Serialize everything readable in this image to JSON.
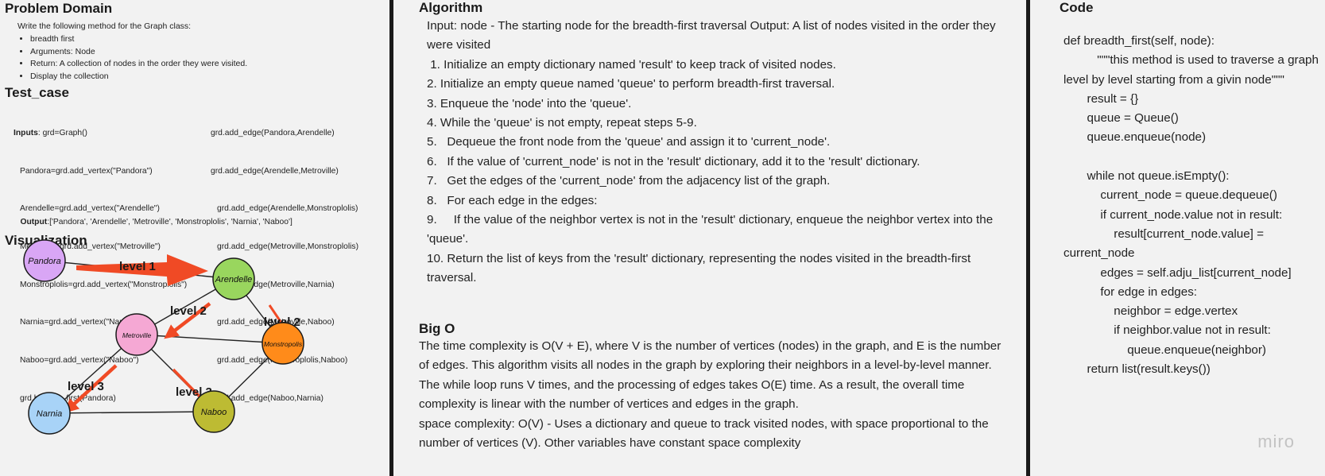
{
  "problem_domain": {
    "title": "Problem Domain",
    "intro": "Write the following method for the Graph class:",
    "bullets": [
      "breadth first",
      "Arguments: Node",
      "Return: A collection of nodes in the order they were visited.",
      "Display the collection"
    ]
  },
  "test_case": {
    "title": "Test_case",
    "inputs_label": "Inputs",
    "left_lines": [
      ": grd=Graph()",
      "Pandora=grd.add_vertex(\"Pandora\")",
      "Arendelle=grd.add_vertex(\"Arendelle\")",
      "Metroville=grd.add_vertex(\"Metroville\")",
      "Monstroplolis=grd.add_vertex(\"Monstroplolis\")",
      "Narnia=grd.add_vertex(\"Narnia\")",
      "Naboo=grd.add_vertex(\"Naboo\")",
      "grd.breadth_first(Pandora)"
    ],
    "right_lines": [
      "grd.add_edge(Pandora,Arendelle)",
      "grd.add_edge(Arendelle,Metroville)",
      "grd.add_edge(Arendelle,Monstroplolis)",
      "grd.add_edge(Metroville,Monstroplolis)",
      "grd.add_edge(Metroville,Narnia)",
      "grd.add_edge(Metroville,Naboo)",
      "grd.add_edge(Monstroplolis,Naboo)",
      "grd.add_edge(Naboo,Narnia)"
    ],
    "output_label": "Output",
    "output_value": ":['Pandora', 'Arendelle', 'Metroville', 'Monstroplolis', 'Narnia', 'Naboo']"
  },
  "visualization": {
    "title": "Visualization",
    "nodes": [
      {
        "id": "pandora",
        "label": "Pandora",
        "color": "#d9a6f5"
      },
      {
        "id": "arendelle",
        "label": "Arendelle",
        "color": "#99d65e"
      },
      {
        "id": "metroville",
        "label": "Metroville",
        "color": "#f5a8d4"
      },
      {
        "id": "monstropolis",
        "label": "Monstropolis",
        "color": "#ff8b1a"
      },
      {
        "id": "narnia",
        "label": "Narnia",
        "color": "#a8d3f7"
      },
      {
        "id": "naboo",
        "label": "Naboo",
        "color": "#bdbb33"
      }
    ],
    "edges": [
      [
        "pandora",
        "arendelle"
      ],
      [
        "arendelle",
        "metroville"
      ],
      [
        "arendelle",
        "monstropolis"
      ],
      [
        "metroville",
        "monstropolis"
      ],
      [
        "metroville",
        "narnia"
      ],
      [
        "metroville",
        "naboo"
      ],
      [
        "monstropolis",
        "naboo"
      ],
      [
        "naboo",
        "narnia"
      ]
    ],
    "level_labels": [
      "level 1",
      "level 2",
      "level 2",
      "level 3",
      "level 3"
    ],
    "arrow_color": "#f04a25"
  },
  "algorithm": {
    "title": "Algorithm",
    "lines": [
      "Input: node - The starting node for the breadth-first traversal Output: A list of nodes visited in the order they were visited",
      " 1. Initialize an empty dictionary named 'result' to keep track of visited nodes.",
      "2. Initialize an empty queue named 'queue' to perform breadth-first traversal.",
      "3. Enqueue the 'node' into the 'queue'.",
      "4. While the 'queue' is not empty, repeat steps 5-9.",
      "5.   Dequeue the front node from the 'queue' and assign it to 'current_node'.",
      "6.   If the value of 'current_node' is not in the 'result' dictionary, add it to the 'result' dictionary.",
      "7.   Get the edges of the 'current_node' from the adjacency list of the graph.",
      "8.   For each edge in the edges:",
      "9.     If the value of the neighbor vertex is not in the 'result' dictionary, enqueue the neighbor vertex into the 'queue'.",
      "10. Return the list of keys from the 'result' dictionary, representing the nodes visited in the breadth-first traversal."
    ]
  },
  "big_o": {
    "title": "Big O",
    "time": "The time complexity  is O(V + E), where V is the number of vertices (nodes) in the graph, and E is the number of edges. This algorithm visits all nodes in the graph by exploring their neighbors in a level-by-level manner. The while loop runs V times, and the processing of edges takes O(E) time. As a result, the overall time complexity is linear with the number of vertices and edges in the graph.",
    "space": "space complexity: O(V) - Uses a dictionary and queue to track visited nodes, with space proportional to the number of vertices (V). Other variables have constant space complexity"
  },
  "code": {
    "title": "Code",
    "lines": [
      "def breadth_first(self, node):",
      "          \"\"\"this method is used to traverse a graph level by level starting from a givin node\"\"\"",
      "       result = {}",
      "       queue = Queue()",
      "       queue.enqueue(node)",
      " ",
      "       while not queue.isEmpty():",
      "           current_node = queue.dequeue()",
      "           if current_node.value not in result:",
      "               result[current_node.value] = current_node",
      "           edges = self.adju_list[current_node]",
      "           for edge in edges:",
      "               neighbor = edge.vertex",
      "               if neighbor.value not in result:",
      "                   queue.enqueue(neighbor)",
      "       return list(result.keys())"
    ]
  },
  "branding": {
    "logo": "miro"
  }
}
